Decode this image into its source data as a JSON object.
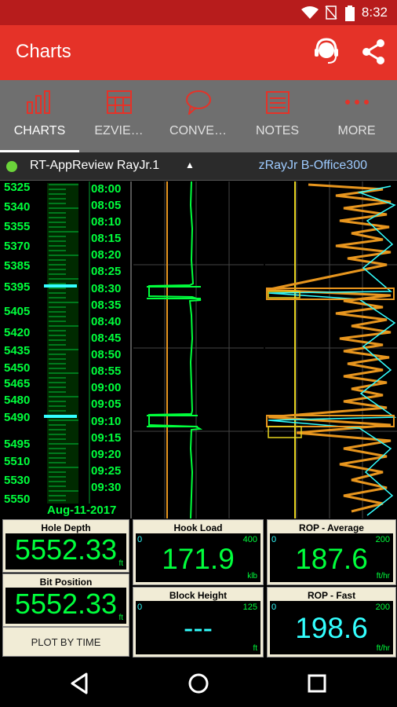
{
  "status": {
    "time": "8:32",
    "icons": [
      "wifi-icon",
      "no-sim-icon",
      "battery-icon"
    ]
  },
  "appbar": {
    "title": "Charts",
    "icons": [
      "support-headset-icon",
      "share-icon"
    ]
  },
  "tabs": [
    {
      "label": "CHARTS",
      "icon": "chart-icon",
      "active": true
    },
    {
      "label": "EZVIE…",
      "icon": "grid-table-icon",
      "active": false
    },
    {
      "label": "CONVE…",
      "icon": "chat-bubble-icon",
      "active": false
    },
    {
      "label": "NOTES",
      "icon": "notes-icon",
      "active": false
    },
    {
      "label": "MORE",
      "icon": "more-dots-icon",
      "active": false
    }
  ],
  "well": {
    "name": "RT-AppReview RayJr.1",
    "rig": "zRayJr B-Office300",
    "status_color": "#6bd43a"
  },
  "depth_labels": [
    "5325",
    "5340",
    "5355",
    "5370",
    "5385",
    "5395",
    "5405",
    "5420",
    "5435",
    "5450",
    "5465",
    "5480",
    "5490",
    "5495",
    "5510",
    "5530",
    "5550"
  ],
  "time_labels": [
    "08:00",
    "08:05",
    "08:10",
    "08:15",
    "08:20",
    "08:25",
    "08:30",
    "08:35",
    "08:40",
    "08:45",
    "08:50",
    "08:55",
    "09:00",
    "09:05",
    "09:10",
    "09:15",
    "09:20",
    "09:25",
    "09:30"
  ],
  "date_label": "Aug-11-2017",
  "gauges": {
    "hole_depth": {
      "title": "Hole Depth",
      "value": "5552.33",
      "unit": "ft"
    },
    "bit_position": {
      "title": "Bit Position",
      "value": "5552.33",
      "unit": "ft"
    },
    "hook_load": {
      "title": "Hook Load",
      "value": "171.9",
      "min": "0",
      "max": "400",
      "unit": "klb"
    },
    "block_height": {
      "title": "Block Height",
      "value": "---",
      "min": "0",
      "max": "125",
      "unit": "ft"
    },
    "rop_average": {
      "title": "ROP - Average",
      "value": "187.6",
      "min": "0",
      "max": "200",
      "unit": "ft/hr"
    },
    "rop_fast": {
      "title": "ROP - Fast",
      "value": "198.6",
      "min": "0",
      "max": "200",
      "unit": "ft/hr"
    }
  },
  "plot_button": "PLOT BY TIME",
  "colors": {
    "accent": "#e53228",
    "trace_green": "#00ff3c",
    "trace_orange": "#e8961e",
    "trace_cyan": "#3ff",
    "trace_yellow": "#e6d21e"
  }
}
